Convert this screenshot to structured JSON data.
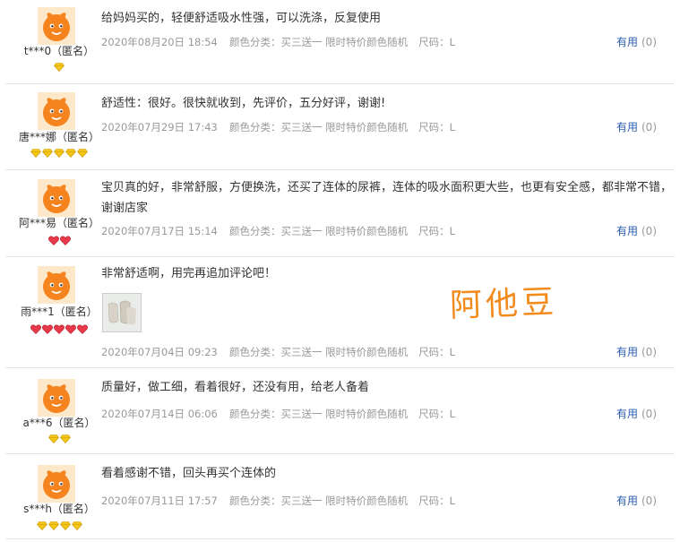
{
  "reviews": [
    {
      "user": "t***0（匿名）",
      "badge_type": "gold",
      "badge_count": 1,
      "text": "给妈妈买的，轻便舒适吸水性强，可以洗涤，反复使用",
      "date": "2020年08月20日 18:54",
      "color_label": "颜色分类：买三送一 限时特价颜色随机",
      "size_label": "尺码：L",
      "useful": "有用",
      "useful_count": "(0)"
    },
    {
      "user": "唐***娜（匿名）",
      "badge_type": "gold",
      "badge_count": 5,
      "text": "舒适性：很好。很快就收到，先评价，五分好评，谢谢!",
      "date": "2020年07月29日 17:43",
      "color_label": "颜色分类：买三送一 限时特价颜色随机",
      "size_label": "尺码：L",
      "useful": "有用",
      "useful_count": "(0)"
    },
    {
      "user": "阿***易（匿名）",
      "badge_type": "red",
      "badge_count": 2,
      "text": "宝贝真的好，非常舒服，方便换洗，还买了连体的尿裤，连体的吸水面积更大些，也更有安全感，都非常不错，谢谢店家",
      "date": "2020年07月17日 15:14",
      "color_label": "颜色分类：买三送一 限时特价颜色随机",
      "size_label": "尺码：L",
      "useful": "有用",
      "useful_count": "(0)"
    },
    {
      "user": "雨***1（匿名）",
      "badge_type": "red",
      "badge_count": 5,
      "text": "非常舒适啊，用完再追加评论吧！",
      "date": "2020年07月04日 09:23",
      "color_label": "颜色分类：买三送一 限时特价颜色随机",
      "size_label": "尺码：L",
      "useful": "有用",
      "useful_count": "(0)"
    },
    {
      "user": "a***6（匿名）",
      "badge_type": "gold",
      "badge_count": 2,
      "text": "质量好，做工细，看着很好，还没有用，给老人备着",
      "date": "2020年07月14日 06:06",
      "color_label": "颜色分类：买三送一 限时特价颜色随机",
      "size_label": "尺码：L",
      "useful": "有用",
      "useful_count": "(0)"
    },
    {
      "user": "s***h（匿名）",
      "badge_type": "gold",
      "badge_count": 4,
      "text": "看着感谢不错，回头再买个连体的",
      "date": "2020年07月11日 17:57",
      "color_label": "颜色分类：买三送一 限时特价颜色随机",
      "size_label": "尺码：L",
      "useful": "有用",
      "useful_count": "(0)"
    }
  ],
  "watermark": "阿他豆",
  "colors": {
    "avatar": "#f5841f",
    "gold_badge": "#f5c518",
    "red_badge": "#e8394a",
    "useful_link": "#2a5db0",
    "meta_text": "#999999",
    "watermark": "#f28a1c"
  },
  "icons": {
    "avatar": "orange-mascot-avatar-icon",
    "gold_badge": "gold-diamond-icon",
    "red_badge": "red-heart-icon"
  }
}
